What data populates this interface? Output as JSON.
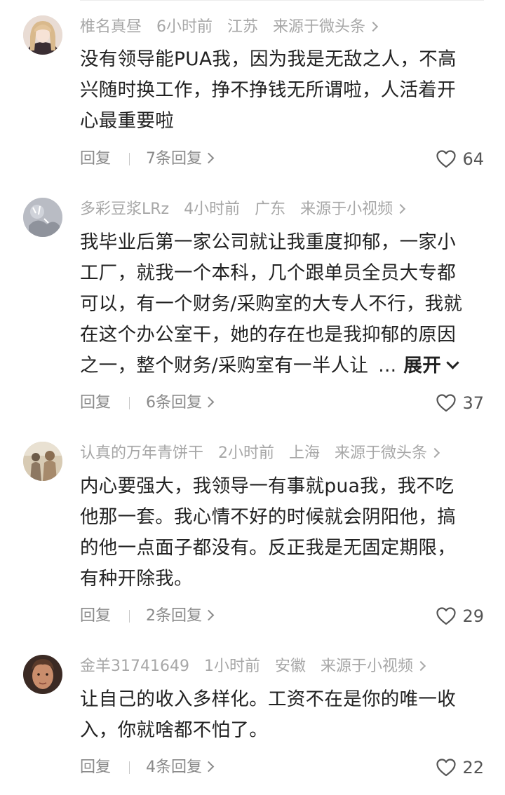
{
  "comments": [
    {
      "user": "椎名真昼",
      "time": "6小时前",
      "location": "江苏",
      "source": "来源于微头条",
      "lines": [
        "没有领导能PUA我，因为我是无敌之人，不高",
        "兴随时换工作，挣不挣钱无所谓啦，人活着开",
        "心最重要啦"
      ],
      "reply_label": "回复",
      "replies_label": "7条回复",
      "likes": "64"
    },
    {
      "user": "多彩豆浆LRz",
      "time": "4小时前",
      "location": "广东",
      "source": "来源于小视频",
      "lines": [
        "我毕业后第一家公司就让我重度抑郁，一家小",
        "工厂，就我一个本科，几个跟单员全员大专都",
        "可以，有一个财务/采购室的大专人不行，我就",
        "在这个办公室干，她的存在也是我抑郁的原因",
        "之一，整个财务/采购室有一半人让"
      ],
      "ellipsis": "...",
      "expand_label": "展开",
      "reply_label": "回复",
      "replies_label": "6条回复",
      "likes": "37"
    },
    {
      "user": "认真的万年青饼干",
      "time": "2小时前",
      "location": "上海",
      "source": "来源于微头条",
      "lines": [
        "内心要强大，我领导一有事就pua我，我不吃",
        "他那一套。我心情不好的时候就会阴阳他，搞",
        "的他一点面子都没有。反正我是无固定期限，",
        "有种开除我。"
      ],
      "reply_label": "回复",
      "replies_label": "2条回复",
      "likes": "29"
    },
    {
      "user": "金羊31741649",
      "time": "1小时前",
      "location": "安徽",
      "source": "来源于小视频",
      "lines": [
        "让自己的收入多样化。工资不在是你的唯一收",
        "入，你就啥都不怕了。"
      ],
      "reply_label": "回复",
      "replies_label": "4条回复",
      "likes": "22"
    }
  ],
  "colors": {
    "meta_text": "#a7a7a7",
    "body_text": "#222222",
    "action_text": "#8a8a8a"
  },
  "icons": {
    "like": "heart-outline-icon",
    "more": "chevron-right-icon",
    "expand": "chevron-down-icon"
  }
}
